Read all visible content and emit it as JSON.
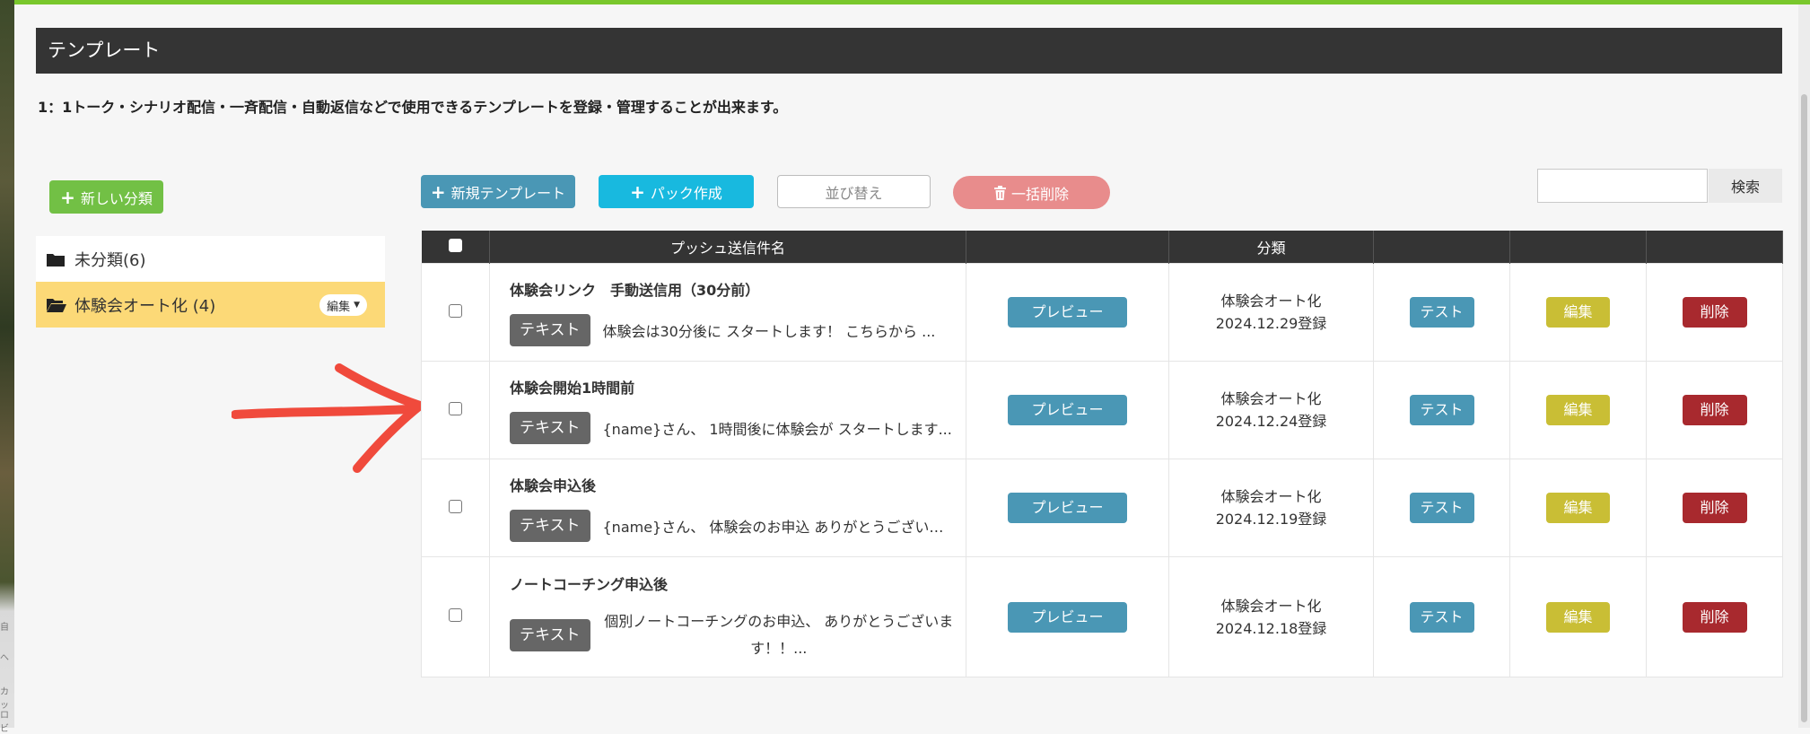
{
  "page": {
    "title": "テンプレート",
    "description": "1：1トーク・シナリオ配信・一斉配信・自動返信などで使用できるテンプレートを登録・管理することが出来ます。"
  },
  "colors": {
    "accent_green": "#79c72c",
    "header_bg": "#343434",
    "preview_blue": "#4a97b5",
    "pack_cyan": "#18b9df",
    "edit_yellow": "#c9be35",
    "delete_red": "#a8292e",
    "active_category": "#fcd977"
  },
  "toolbar": {
    "new_category": "新しい分類",
    "new_template": "新規テンプレート",
    "pack_create": "パック作成",
    "sort": "並び替え",
    "bulk_delete": "一括削除",
    "search_button": "検索",
    "search_value": ""
  },
  "categories": [
    {
      "label": "未分類(6)",
      "icon": "folder-icon",
      "active": false
    },
    {
      "label": "体験会オート化 (4)",
      "icon": "folder-open-icon",
      "active": true,
      "edit_label": "編集"
    }
  ],
  "table": {
    "headers": [
      "",
      "プッシュ送信件名",
      "",
      "分類",
      "",
      "",
      ""
    ],
    "rows": [
      {
        "title": "体験会リンク　手動送信用（30分前）",
        "tag": "テキスト",
        "text": "体験会は30分後に スタートします！ こちらから ...",
        "category": "体験会オート化",
        "date": "2024.12.29登録"
      },
      {
        "title": "体験会開始1時間前",
        "tag": "テキスト",
        "text": "{name}さん、 1時間後に体験会が スタートします...",
        "category": "体験会オート化",
        "date": "2024.12.24登録"
      },
      {
        "title": "体験会申込後",
        "tag": "テキスト",
        "text": "{name}さん、 体験会のお申込 ありがとうございま...",
        "category": "体験会オート化",
        "date": "2024.12.19登録"
      },
      {
        "title": "ノートコーチング申込後",
        "tag": "テキスト",
        "text": "個別ノートコーチングのお申込、 ありがとうございます！！...",
        "category": "体験会オート化",
        "date": "2024.12.18登録"
      }
    ],
    "actions": {
      "preview": "プレビュー",
      "test": "テスト",
      "edit": "編集",
      "delete": "削除"
    }
  },
  "side_ghost": [
    "自",
    "へ",
    "カッ",
    "ロビ"
  ]
}
